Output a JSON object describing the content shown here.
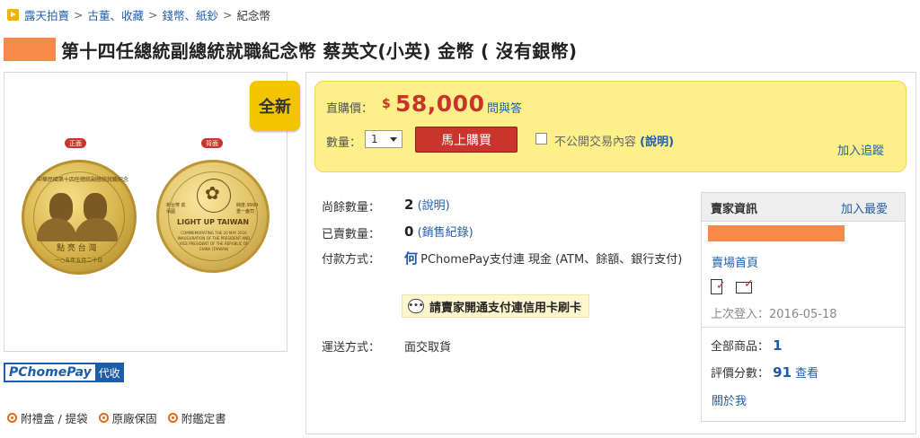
{
  "breadcrumb": {
    "items": [
      "露天拍賣",
      "古董、收藏",
      "錢幣、紙鈔",
      "紀念幣"
    ],
    "separator": ">"
  },
  "product": {
    "title": "第十四任總統副總統就職紀念幣 蔡英文(小英) 金幣 ( 沒有銀幣)",
    "condition_badge": "全新"
  },
  "coin_images": {
    "front_label": "正面",
    "back_label": "背面",
    "front_top_text": "中華民國第十四任總統副總統就職紀念",
    "front_bottom_text": "點 亮 台 灣",
    "front_date_text": "一○五年五月二十日",
    "back_title": "LIGHT UP TAIWAN",
    "back_caption": "COMMEMORATING THE 20 MAY 2016 INAUGURATION OF THE PRESIDENT AND VICE PRESIDENT OF THE REPUBLIC OF CHINA (TAIWAN)",
    "back_left_text": "新台幣 貳佰圓",
    "back_right_text": "純度.9999 重一盎司"
  },
  "payment_badge": {
    "logo_text": "PChomePay",
    "tag_text": "代收"
  },
  "features": [
    "附禮盒 / 提袋",
    "原廠保固",
    "附鑑定書"
  ],
  "buy_box": {
    "price_label": "直購價：",
    "currency_symbol": "$",
    "price": "58,000",
    "qa_link": "問與答",
    "quantity_label": "數量：",
    "quantity_value": "1",
    "buy_button": "馬上購買",
    "private_label": "不公開交易內容",
    "private_help_link": "(說明)",
    "private_checked": false,
    "track_link": "加入追蹤"
  },
  "details": {
    "remaining_label": "尚餘數量：",
    "remaining_value": "2",
    "remaining_link": "(說明)",
    "sold_label": "已賣數量：",
    "sold_value": "0",
    "sold_link": "(銷售紀錄)",
    "payment_label": "付款方式：",
    "payment_value": "PChomePay支付連 現金 (ATM、餘額、銀行支付)",
    "card_notice": "請賣家開通支付連信用卡刷卡",
    "shipping_label": "運送方式：",
    "shipping_value": "面交取貨"
  },
  "seller": {
    "header": "賣家資訊",
    "add_favorite": "加入最愛",
    "shop_link": "賣場首頁",
    "last_login": "上次登入：2016-05-18",
    "total_items_label": "全部商品：",
    "total_items_value": "1",
    "rating_label": "評價分數：",
    "rating_value": "91",
    "rating_link": "查看",
    "about_link": "關於我"
  },
  "colors": {
    "link": "#1f5fa8",
    "price_red": "#c9342c",
    "buy_box_yellow": "#fdf08a",
    "badge_yellow": "#f5c400",
    "redaction_orange": "#f58a4a"
  }
}
